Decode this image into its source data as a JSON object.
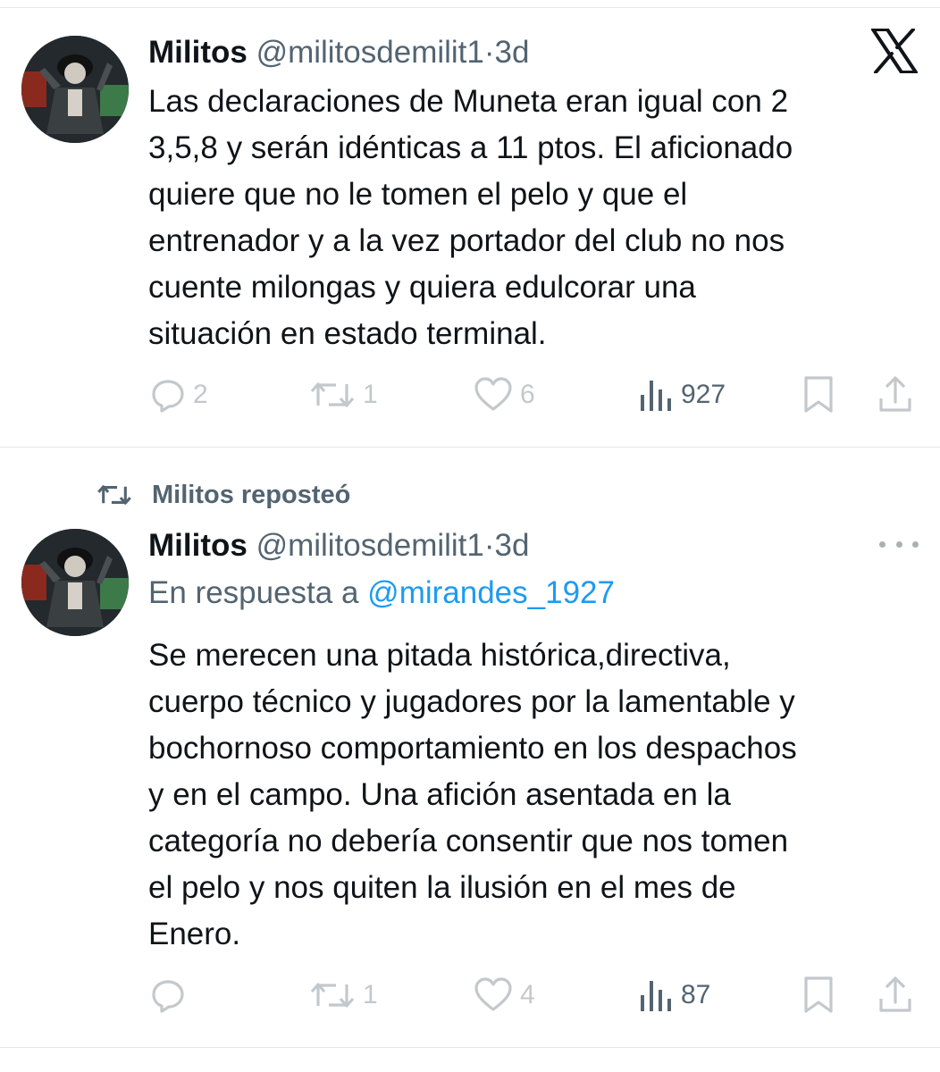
{
  "tweets": [
    {
      "author_name": "Militos",
      "handle": "@militosdemilit1",
      "separator": "·",
      "time": "3d",
      "text": "Las declaraciones de Muneta eran igual con 2\n3,5,8 y serán idénticas a 11 ptos. El aficionado\nquiere que no le tomen el pelo y que el\nentrenador y a la vez portador del club no nos\ncuente milongas y quiera edulcorar una\nsituación en estado terminal.",
      "replies": "2",
      "reposts": "1",
      "likes": "6",
      "views": "927"
    },
    {
      "repost_label": "Militos reposteó",
      "author_name": "Militos",
      "handle": "@militosdemilit1",
      "separator": "·",
      "time": "3d",
      "reply_prefix": "En respuesta a",
      "reply_to": "@mirandes_1927",
      "text": "Se merecen una pitada histórica,directiva,\ncuerpo técnico y jugadores por la lamentable y\nbochornoso comportamiento en los despachos\ny en el campo. Una afición asentada en la\ncategoría no debería consentir que nos tomen\nel pelo y nos quiten la ilusión en el mes de\nEnero.",
      "replies": "",
      "reposts": "1",
      "likes": "4",
      "views": "87"
    }
  ],
  "icons": {
    "brand": "x-logo-icon",
    "reply": "reply-icon",
    "repost": "repost-icon",
    "like": "heart-icon",
    "views": "views-icon",
    "bookmark": "bookmark-icon",
    "share": "share-icon",
    "more": "more-icon"
  },
  "colors": {
    "text": "#0f1419",
    "secondary": "#536471",
    "mention": "#1d9bf0",
    "muted_icon": "#c3c8cc",
    "divider": "#e4e6e8"
  }
}
